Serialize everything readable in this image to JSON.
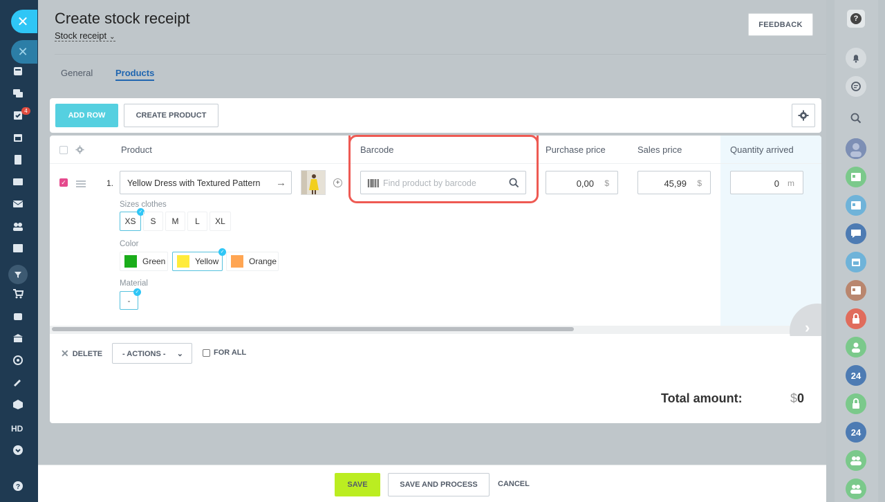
{
  "page": {
    "title": "Create stock receipt",
    "subtitle": "Stock receipt",
    "feedback_label": "FEEDBACK"
  },
  "tabs": [
    {
      "label": "General",
      "active": false
    },
    {
      "label": "Products",
      "active": true
    }
  ],
  "toolbar": {
    "add_row_label": "ADD ROW",
    "create_product_label": "CREATE PRODUCT"
  },
  "columns": {
    "product": "Product",
    "barcode": "Barcode",
    "purchase_price": "Purchase price",
    "sales_price": "Sales price",
    "quantity_arrived": "Quantity arrived"
  },
  "row": {
    "number": "1.",
    "product_name": "Yellow Dress with Textured Pattern",
    "barcode_placeholder": "Find product by barcode",
    "purchase_price": "0,00",
    "purchase_currency": "$",
    "sales_price": "45,99",
    "sales_currency": "$",
    "quantity": "0",
    "quantity_unit": "m",
    "checked": true
  },
  "properties": {
    "sizes_label": "Sizes clothes",
    "sizes": [
      "XS",
      "S",
      "M",
      "L",
      "XL"
    ],
    "selected_size": "XS",
    "color_label": "Color",
    "colors": [
      {
        "name": "Green",
        "hex": "#1aad1a"
      },
      {
        "name": "Yellow",
        "hex": "#ffeb3b"
      },
      {
        "name": "Orange",
        "hex": "#ffa552"
      }
    ],
    "selected_color": "Yellow",
    "material_label": "Material",
    "material_value": "-"
  },
  "bottom": {
    "delete_label": "DELETE",
    "actions_label": "- ACTIONS -",
    "for_all_label": "FOR ALL",
    "total_label": "Total amount:",
    "total_currency": "$",
    "total_value": "0"
  },
  "footer": {
    "save_label": "SAVE",
    "save_process_label": "SAVE AND PROCESS",
    "cancel_label": "CANCEL"
  },
  "sidebar": {
    "badge_count": "4",
    "hd_label": "HD"
  },
  "right_bar": {
    "help_label": "?",
    "items": [
      {
        "icon": "bell-icon"
      },
      {
        "icon": "chat-icon"
      },
      {
        "icon": "search-icon"
      },
      {
        "icon": "avatar",
        "color": "#6a7fa8"
      },
      {
        "icon": "contact-card-icon",
        "color": "#7bc98b"
      },
      {
        "icon": "contact-card-icon",
        "color": "#6fb3d9"
      },
      {
        "icon": "group-chat-icon",
        "color": "#4d7bb3"
      },
      {
        "icon": "calendar-icon",
        "color": "#6fb3d9"
      },
      {
        "icon": "contact-card-icon",
        "color": "#b9866e"
      },
      {
        "icon": "lock-icon",
        "color": "#e06c5c"
      },
      {
        "icon": "user-icon",
        "color": "#7bc98b"
      },
      {
        "label": "24",
        "color": "#4d7bb3"
      },
      {
        "icon": "lock-icon",
        "color": "#7bc98b"
      },
      {
        "label": "24",
        "color": "#4d7bb3"
      },
      {
        "icon": "users-icon",
        "color": "#7bc98b"
      },
      {
        "icon": "users-icon",
        "color": "#7bc98b"
      }
    ]
  }
}
